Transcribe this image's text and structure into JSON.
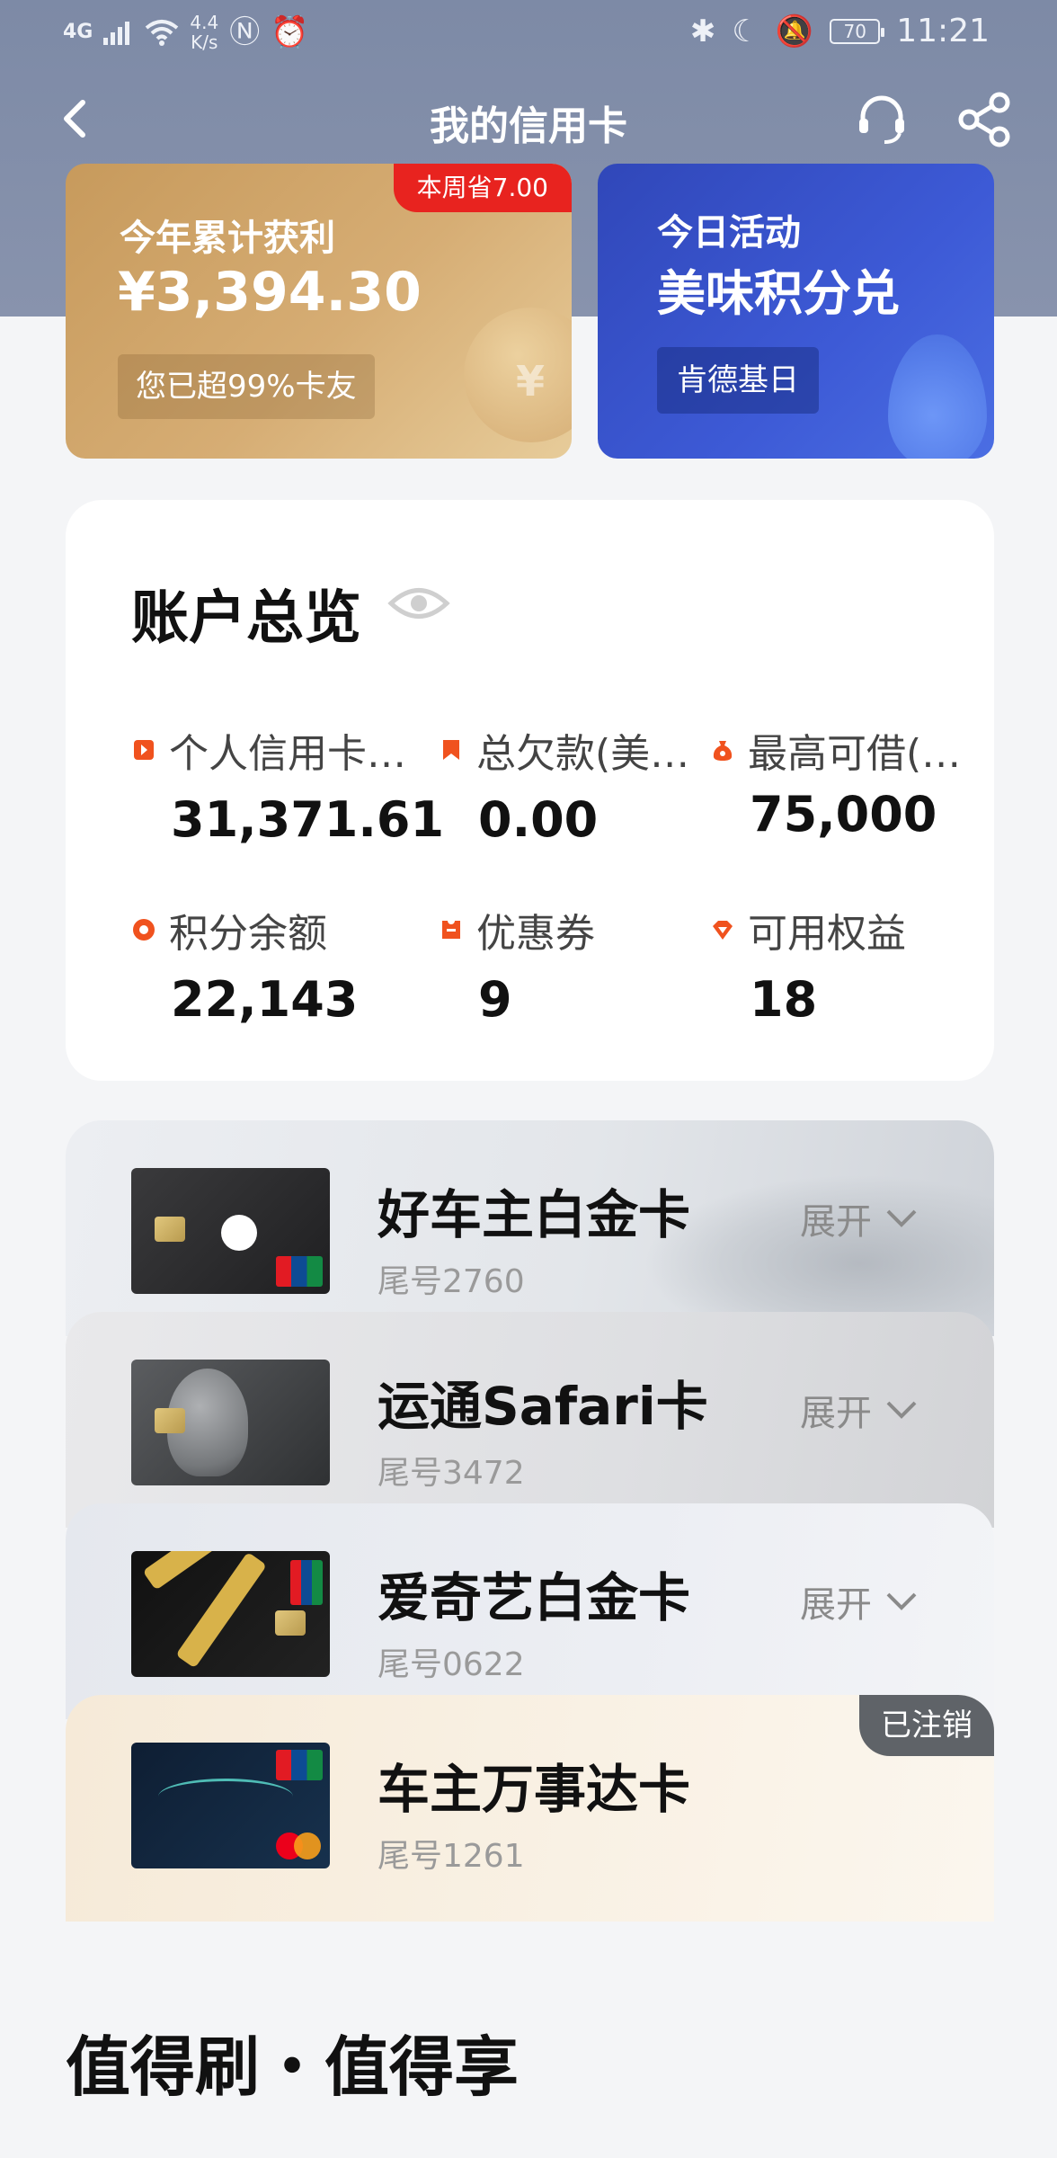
{
  "status_bar": {
    "network": "4G",
    "speed": "4.4\nK/s",
    "battery": "70",
    "time": "11:21"
  },
  "nav": {
    "title": "我的信用卡"
  },
  "promo": {
    "profit": {
      "badge": "本周省7.00",
      "label": "今年累计获利",
      "amount": "¥3,394.30",
      "pill": "您已超99%卡友"
    },
    "activity": {
      "label": "今日活动",
      "title": "美味积分兑",
      "pill": "肯德基日"
    }
  },
  "overview": {
    "title": "账户总览",
    "items": [
      {
        "label": "个人信用卡…",
        "value": "31,371.61",
        "icon": "flag-icon"
      },
      {
        "label": "总欠款(美…",
        "value": "0.00",
        "icon": "bookmark-icon"
      },
      {
        "label": "最高可借(…",
        "value": "75,000",
        "icon": "money-bag-icon"
      },
      {
        "label": "积分余额",
        "value": "22,143",
        "icon": "points-icon"
      },
      {
        "label": "优惠券",
        "value": "9",
        "icon": "coupon-icon"
      },
      {
        "label": "可用权益",
        "value": "18",
        "icon": "diamond-icon"
      }
    ]
  },
  "cards": [
    {
      "name": "好车主白金卡",
      "tail": "尾号2760",
      "action": "展开"
    },
    {
      "name": "运通Safari卡",
      "tail": "尾号3472",
      "action": "展开"
    },
    {
      "name": "爱奇艺白金卡",
      "tail": "尾号0622",
      "action": "展开"
    },
    {
      "name": "车主万事达卡",
      "tail": "尾号1261",
      "badge": "已注销"
    }
  ],
  "section": {
    "title": "值得刷・值得享"
  },
  "colors": {
    "header": "#7d8aa6",
    "accent_red": "#e8231f",
    "icon_orange": "#f0521e",
    "activity_blue": "#3047b9",
    "profit_gold": "#c79a5c"
  }
}
